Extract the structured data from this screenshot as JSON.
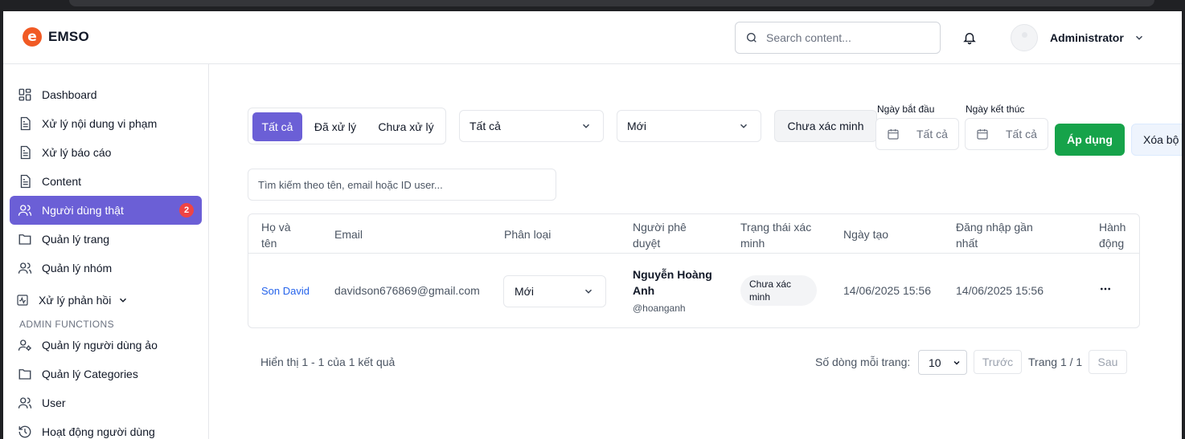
{
  "brand": {
    "name": "EMSO",
    "accent": "#f15a24",
    "primary": "#6b5fd6",
    "success": "#16a34a"
  },
  "header": {
    "search_placeholder": "Search content...",
    "user_name": "Administrator"
  },
  "sidebar": {
    "items": [
      {
        "label": "Dashboard",
        "icon": "dashboard-icon"
      },
      {
        "label": "Xử lý nội dung vi phạm",
        "icon": "document-icon"
      },
      {
        "label": "Xử lý báo cáo",
        "icon": "document-icon"
      },
      {
        "label": "Content",
        "icon": "document-icon"
      },
      {
        "label": "Người dùng thật",
        "icon": "users-icon",
        "badge": "2",
        "active": true
      },
      {
        "label": "Quản lý trang",
        "icon": "folder-icon"
      },
      {
        "label": "Quản lý nhóm",
        "icon": "users-icon"
      },
      {
        "label": "Xử lý phản hồi",
        "icon": "activity-icon"
      }
    ],
    "section_title": "ADMIN FUNCTIONS",
    "admin_items": [
      {
        "label": "Quản lý người dùng ảo",
        "icon": "user-cog-icon"
      },
      {
        "label": "Quản lý Categories",
        "icon": "folder-icon"
      },
      {
        "label": "User",
        "icon": "users-icon"
      },
      {
        "label": "Hoạt động người dùng",
        "icon": "history-icon"
      }
    ]
  },
  "filters": {
    "tabs": [
      "Tất cả",
      "Đã xử lý",
      "Chưa xử lý"
    ],
    "active_tab": "Tất cả",
    "select_1": "Tất cả",
    "select_2": "Mới",
    "unverified_button": "Chưa xác minh",
    "start_date_label": "Ngày bắt đầu",
    "start_date_value": "Tất cả",
    "end_date_label": "Ngày kết thúc",
    "end_date_value": "Tất cả",
    "apply_button": "Áp dụng",
    "clear_button": "Xóa bộ lọc",
    "search_placeholder": "Tìm kiếm theo tên, email hoặc ID user..."
  },
  "table": {
    "headers": {
      "name": [
        "Họ và",
        "tên"
      ],
      "email": "Email",
      "category": "Phân loại",
      "approver": [
        "Người phê",
        "duyệt"
      ],
      "status": [
        "Trạng thái xác",
        "minh"
      ],
      "created": "Ngày tạo",
      "last_login": [
        "Đăng nhập gần",
        "nhất"
      ],
      "action": [
        "Hành",
        "động"
      ]
    },
    "rows": [
      {
        "name": "Son David",
        "email": "davidson676869@gmail.com",
        "category": "Mới",
        "approver_name": "Nguyễn Hoàng Anh",
        "approver_handle": "@hoanganh",
        "status": [
          "Chưa xác",
          "minh"
        ],
        "created": "14/06/2025 15:56",
        "last_login": "14/06/2025 15:56"
      }
    ]
  },
  "pagination": {
    "info": "Hiển thị 1 - 1 của 1 kết quả",
    "rows_per_page_label": "Số dòng mỗi trang:",
    "rows_per_page": "10",
    "prev": "Trước",
    "page": "Trang 1 / 1",
    "next": "Sau"
  }
}
